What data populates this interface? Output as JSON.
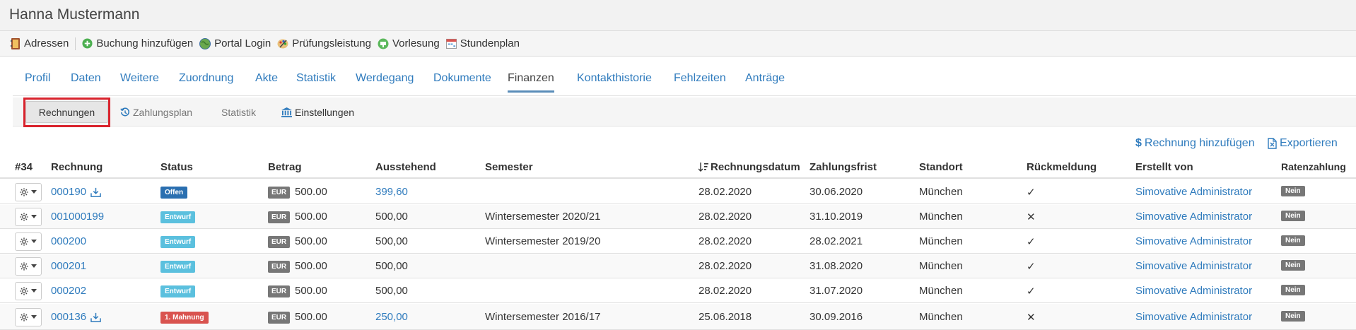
{
  "header": {
    "title": "Hanna Mustermann"
  },
  "toolbar": {
    "items": [
      {
        "label": "Adressen",
        "icon": "address-book-icon"
      },
      {
        "label": "Buchung hinzufügen",
        "icon": "add-circle-icon"
      },
      {
        "label": "Portal Login",
        "icon": "globe-icon"
      },
      {
        "label": "Prüfungsleistung",
        "icon": "palette-icon"
      },
      {
        "label": "Vorlesung",
        "icon": "lecture-icon"
      },
      {
        "label": "Stundenplan",
        "icon": "calendar-icon"
      }
    ]
  },
  "tabs": [
    {
      "label": "Profil"
    },
    {
      "label": "Daten"
    },
    {
      "label": "Weitere"
    },
    {
      "label": "Zuordnung"
    },
    {
      "label": "Akte"
    },
    {
      "label": "Statistik"
    },
    {
      "label": "Werdegang"
    },
    {
      "label": "Dokumente"
    },
    {
      "label": "Finanzen",
      "active": true
    },
    {
      "label": "Kontakthistorie"
    },
    {
      "label": "Fehlzeiten"
    },
    {
      "label": "Anträge"
    }
  ],
  "subtabs": {
    "rechnungen": "Rechnungen",
    "zahlungsplan": "Zahlungsplan",
    "statistik": "Statistik",
    "einstellungen": "Einstellungen"
  },
  "actions": {
    "add_invoice": "Rechnung hinzufügen",
    "export": "Exportieren"
  },
  "table": {
    "headers": {
      "count": "#34",
      "rechnung": "Rechnung",
      "status": "Status",
      "betrag": "Betrag",
      "ausstehend": "Ausstehend",
      "semester": "Semester",
      "rechnungsdatum": "Rechnungsdatum",
      "zahlungsfrist": "Zahlungsfrist",
      "standort": "Standort",
      "rueckmeldung": "Rückmeldung",
      "erstellt_von": "Erstellt von",
      "ratenzahlung": "Ratenzahlung"
    },
    "rows": [
      {
        "rechnung": "000190",
        "download": true,
        "status": "Offen",
        "status_type": "offen",
        "currency": "EUR",
        "betrag": "500.00",
        "ausstehend": "399,60",
        "ausstehend_link": true,
        "semester": "",
        "rechnungsdatum": "28.02.2020",
        "zahlungsfrist": "30.06.2020",
        "standort": "München",
        "rueckmeldung": "✓",
        "erstellt_von": "Simovative Administrator",
        "ratenzahlung": "Nein"
      },
      {
        "rechnung": "001000199",
        "download": false,
        "status": "Entwurf",
        "status_type": "entwurf",
        "currency": "EUR",
        "betrag": "500.00",
        "ausstehend": "500,00",
        "ausstehend_link": false,
        "semester": "Wintersemester 2020/21",
        "rechnungsdatum": "28.02.2020",
        "zahlungsfrist": "31.10.2019",
        "standort": "München",
        "rueckmeldung": "✕",
        "erstellt_von": "Simovative Administrator",
        "ratenzahlung": "Nein"
      },
      {
        "rechnung": "000200",
        "download": false,
        "status": "Entwurf",
        "status_type": "entwurf",
        "currency": "EUR",
        "betrag": "500.00",
        "ausstehend": "500,00",
        "ausstehend_link": false,
        "semester": "Wintersemester 2019/20",
        "rechnungsdatum": "28.02.2020",
        "zahlungsfrist": "28.02.2021",
        "standort": "München",
        "rueckmeldung": "✓",
        "erstellt_von": "Simovative Administrator",
        "ratenzahlung": "Nein"
      },
      {
        "rechnung": "000201",
        "download": false,
        "status": "Entwurf",
        "status_type": "entwurf",
        "currency": "EUR",
        "betrag": "500.00",
        "ausstehend": "500,00",
        "ausstehend_link": false,
        "semester": "",
        "rechnungsdatum": "28.02.2020",
        "zahlungsfrist": "31.08.2020",
        "standort": "München",
        "rueckmeldung": "✓",
        "erstellt_von": "Simovative Administrator",
        "ratenzahlung": "Nein"
      },
      {
        "rechnung": "000202",
        "download": false,
        "status": "Entwurf",
        "status_type": "entwurf",
        "currency": "EUR",
        "betrag": "500.00",
        "ausstehend": "500,00",
        "ausstehend_link": false,
        "semester": "",
        "rechnungsdatum": "28.02.2020",
        "zahlungsfrist": "31.07.2020",
        "standort": "München",
        "rueckmeldung": "✓",
        "erstellt_von": "Simovative Administrator",
        "ratenzahlung": "Nein"
      },
      {
        "rechnung": "000136",
        "download": true,
        "status": "1. Mahnung",
        "status_type": "mahnung",
        "currency": "EUR",
        "betrag": "500.00",
        "ausstehend": "250,00",
        "ausstehend_link": true,
        "semester": "Wintersemester 2016/17",
        "rechnungsdatum": "25.06.2018",
        "zahlungsfrist": "30.09.2016",
        "standort": "München",
        "rueckmeldung": "✕",
        "erstellt_von": "Simovative Administrator",
        "ratenzahlung": "Nein"
      }
    ]
  },
  "colors": {
    "link": "#2f7bbd",
    "offen": "#2a6fb0",
    "entwurf": "#5bc0de",
    "mahnung": "#d9534f",
    "highlight": "#d9232d"
  }
}
